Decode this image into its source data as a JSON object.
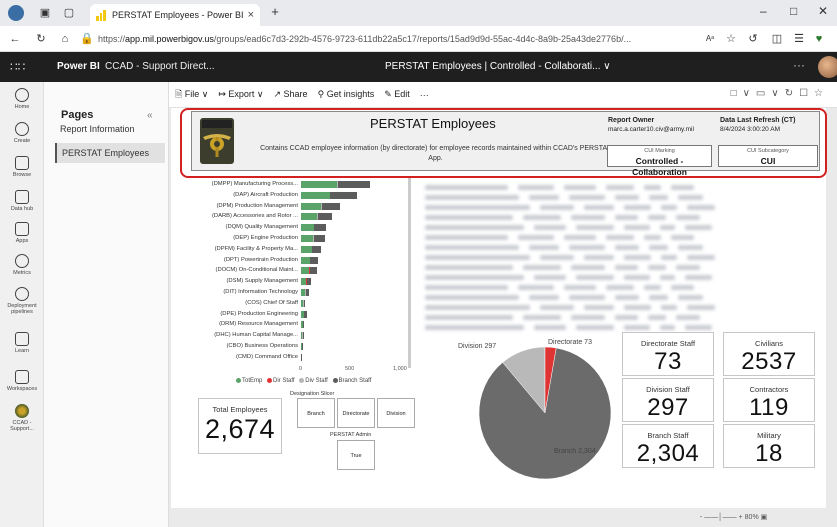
{
  "browser": {
    "tab_title": "PERSTAT Employees - Power BI",
    "tab_close": "×",
    "new_tab": "+",
    "url_prefix": "https://",
    "url_host": "app.mil.powerbigov.us",
    "url_path": "/groups/ead6c7d3-292b-4576-9723-611db22a5c17/reports/15ad9d9d-55ac-4d4c-8a9b-25a43de2776b/...",
    "read_aloud": "Aᵃ"
  },
  "pbi_header": {
    "brand": "Power BI",
    "workspace": "CCAD - Support Direct...",
    "report_title": "PERSTAT Employees",
    "separator": "|",
    "label": "Controlled - Collaborati...",
    "more": "···"
  },
  "rail": [
    {
      "name": "rail-home",
      "label": "Home"
    },
    {
      "name": "rail-create",
      "label": "Create"
    },
    {
      "name": "rail-browse",
      "label": "Browse"
    },
    {
      "name": "rail-datahub",
      "label": "Data hub"
    },
    {
      "name": "rail-apps",
      "label": "Apps"
    },
    {
      "name": "rail-metrics",
      "label": "Metrics"
    },
    {
      "name": "rail-deployment",
      "label": "Deployment pipelines"
    },
    {
      "name": "rail-learn",
      "label": "Learn"
    },
    {
      "name": "rail-workspaces",
      "label": "Workspaces"
    },
    {
      "name": "rail-ccad",
      "label": "CCAD - Support..."
    }
  ],
  "pages_pane": {
    "title": "Pages",
    "collapse": "«",
    "items": [
      "Report Information",
      "PERSTAT Employees"
    ]
  },
  "toolbar": {
    "file": "File ∨",
    "export": "↦ Export ∨",
    "share": "Share",
    "insights": "Get insights",
    "edit": "Edit",
    "more": "···"
  },
  "banner": {
    "title": "PERSTAT Employees",
    "description": "Contains CCAD employee information (by directorate) for employee records maintained within CCAD's PERSTAT App.",
    "owner_label": "Report Owner",
    "owner_value": "marc.a.carter10.civ@army.mil",
    "refresh_label": "Data Last Refresh (CT)",
    "refresh_value": "8/4/2024 3:00:20 AM",
    "cui_marking_label": "CUI Marking",
    "cui_marking_value": "Controlled - Collaboration",
    "cui_sub_label": "CUI Subcategory",
    "cui_sub_value": "CUI"
  },
  "chart_data": [
    {
      "type": "bar",
      "orientation": "horizontal",
      "stacked": true,
      "categories": [
        "(DMPP) Manufacturing Process...",
        "(DAP) Aircraft Production",
        "(DPM) Production Management",
        "(DARB) Accessories and Rotor ...",
        "(DQM) Quality Management",
        "(DEP) Engine Production",
        "(DPFM) Facility & Property Ma...",
        "(DPT) Powertrain Production",
        "(DOCM) On-Conditional Maint...",
        "(DSM) Supply Management",
        "(DIT) Information Technology",
        "(COS) Chief Of Staff",
        "(DPE) Production Engineering",
        "(DRM) Resource Management",
        "(DHC) Human Capital Manage...",
        "(CBO) Business Operations",
        "(CMD) Command Office"
      ],
      "series": [
        {
          "name": "TotEmp",
          "color": "#5aa469",
          "values": [
            375,
            300,
            210,
            170,
            135,
            130,
            110,
            90,
            85,
            55,
            45,
            25,
            30,
            18,
            14,
            7,
            3
          ]
        },
        {
          "name": "Div Staff",
          "color": "#b5b5b5",
          "values": [
            8,
            6,
            5,
            5,
            4,
            4,
            3,
            3,
            3,
            2,
            2,
            4,
            2,
            2,
            2,
            1,
            1
          ]
        },
        {
          "name": "Branch Staff",
          "color": "#5c5c5c",
          "values": [
            340,
            280,
            190,
            150,
            125,
            110,
            95,
            85,
            75,
            50,
            40,
            10,
            25,
            12,
            10,
            2,
            1
          ]
        },
        {
          "name": "Dir Staff",
          "color": "#e03434",
          "values": [
            1,
            1,
            1,
            1,
            1,
            1,
            1,
            1,
            1,
            1,
            1,
            4,
            1,
            1,
            1,
            0,
            0
          ]
        }
      ],
      "xticks": [
        "0",
        "500",
        "1,000"
      ],
      "xlim": [
        0,
        1000
      ],
      "legend_order": [
        "TotEmp",
        "Dir Staff",
        "Div Staff",
        "Branch Staff"
      ]
    },
    {
      "type": "pie",
      "slices": [
        {
          "label": "Branch",
          "value": 2304,
          "color": "#6b6b6b"
        },
        {
          "label": "Division",
          "value": 297,
          "color": "#b9b9b9"
        },
        {
          "label": "Directorate",
          "value": 73,
          "color": "#e03434"
        }
      ]
    }
  ],
  "pie_labels": {
    "division": "Division 297",
    "directorate": "Directorate 73",
    "branch": "Branch 2,304"
  },
  "slicers": {
    "designation_title": "Designation Slicer",
    "designation_options": [
      "Branch",
      "Directorate",
      "Division"
    ],
    "admin_title": "PERSTAT Admin",
    "admin_options": [
      "True"
    ]
  },
  "cards": {
    "total": {
      "label": "Total Employees",
      "value": "2,674"
    },
    "directorate": {
      "label": "Directorate Staff",
      "value": "73"
    },
    "division": {
      "label": "Division Staff",
      "value": "297"
    },
    "branch": {
      "label": "Branch Staff",
      "value": "2,304"
    },
    "civilians": {
      "label": "Civilians",
      "value": "2537"
    },
    "contractors": {
      "label": "Contractors",
      "value": "119"
    },
    "military": {
      "label": "Military",
      "value": "18"
    }
  },
  "statusbar": {
    "zoom": "80%",
    "minus": "-",
    "plus": "+"
  }
}
